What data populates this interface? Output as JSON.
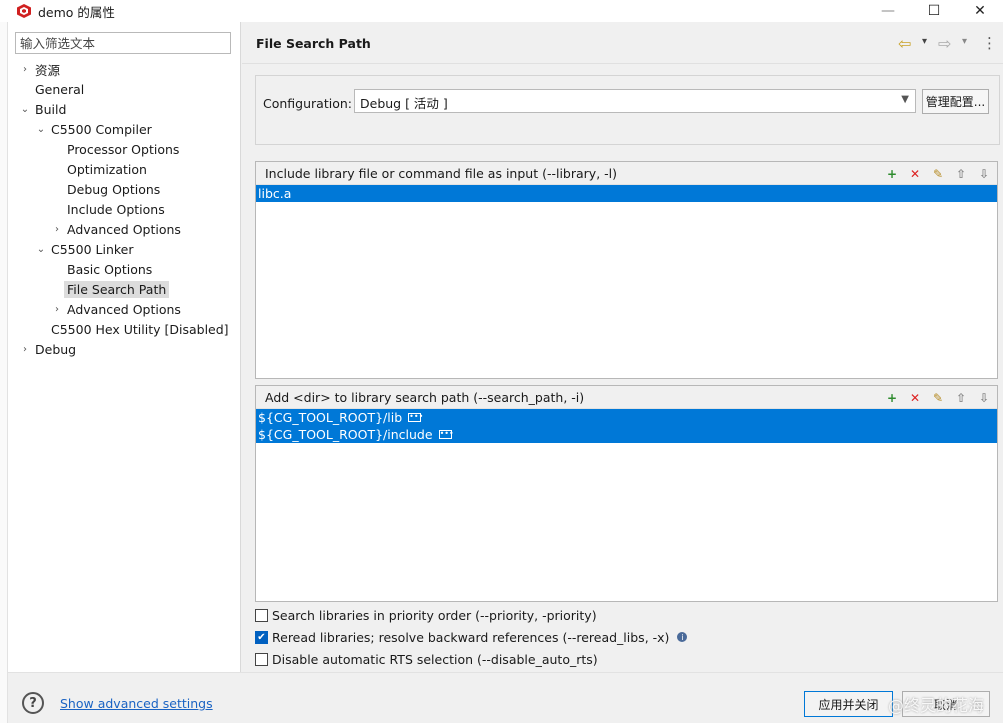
{
  "window": {
    "title": "demo 的属性",
    "minimize": "—",
    "maximize": "☐",
    "close": "✕"
  },
  "filter": {
    "placeholder": "输入筛选文本"
  },
  "tree": [
    {
      "label": "资源",
      "twisty": "›"
    },
    {
      "label": "General",
      "twisty": ""
    },
    {
      "label": "Build",
      "twisty": "⌄"
    },
    {
      "label": "C5500 Compiler",
      "twisty": "⌄"
    },
    {
      "label": "Processor Options",
      "twisty": ""
    },
    {
      "label": "Optimization",
      "twisty": ""
    },
    {
      "label": "Debug Options",
      "twisty": ""
    },
    {
      "label": "Include Options",
      "twisty": ""
    },
    {
      "label": "Advanced Options",
      "twisty": "›"
    },
    {
      "label": "C5500 Linker",
      "twisty": "⌄"
    },
    {
      "label": "Basic Options",
      "twisty": ""
    },
    {
      "label": "File Search Path",
      "twisty": ""
    },
    {
      "label": "Advanced Options",
      "twisty": "›"
    },
    {
      "label": "C5500 Hex Utility  [Disabled]",
      "twisty": ""
    },
    {
      "label": "Debug",
      "twisty": "›"
    }
  ],
  "header": {
    "title": "File Search Path",
    "back": "⇦",
    "back_menu": "▾",
    "forward": "⇨",
    "forward_menu": "▾",
    "more": "⋮"
  },
  "configuration": {
    "label": "Configuration:",
    "value": "Debug  [ 活动 ]",
    "manage_button": "管理配置..."
  },
  "library_group": {
    "title": "Include library file or command file as input (--library, -l)",
    "items": [
      "libc.a"
    ]
  },
  "search_path_group": {
    "title": "Add <dir> to library search path (--search_path, -i)",
    "items": [
      "${CG_TOOL_ROOT}/lib",
      "${CG_TOOL_ROOT}/include"
    ]
  },
  "tools": {
    "add": "+",
    "delete": "✕",
    "edit": "✎",
    "up": "⇧",
    "down": "⇩"
  },
  "options": [
    {
      "label": "Search libraries in priority order (--priority, -priority)",
      "checked": false
    },
    {
      "label": "Reread libraries; resolve backward references (--reread_libs, -x)",
      "checked": true
    },
    {
      "label": "Disable automatic RTS selection (--disable_auto_rts)",
      "checked": false
    }
  ],
  "bottom": {
    "help": "?",
    "advanced_link": "Show advanced settings",
    "apply_close": "应用并关闭",
    "cancel": "取消",
    "watermark": "@终灵的花海"
  },
  "colors": {
    "selection": "#0078d7",
    "link": "#1a63c3"
  }
}
